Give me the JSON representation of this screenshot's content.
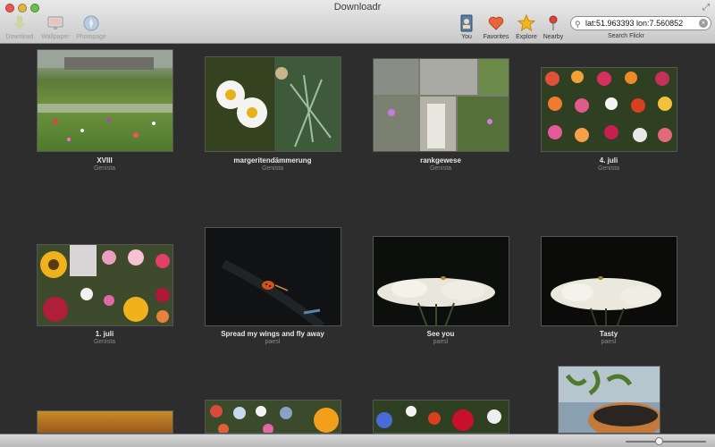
{
  "window": {
    "title": "Downloadr"
  },
  "toolbar": {
    "download_label": "Download",
    "wallpaper_label": "Wallpaper",
    "photopage_label": "Photopage",
    "you_label": "You",
    "favorites_label": "Favorites",
    "explore_label": "Explore",
    "nearby_label": "Nearby"
  },
  "search": {
    "value": "lat:51.963393 lon:7.560852",
    "label": "Search Flickr"
  },
  "photos": [
    {
      "title": "XVIII",
      "owner": "Genista"
    },
    {
      "title": "margeritendämmerung",
      "owner": "Genista"
    },
    {
      "title": "rankgewese",
      "owner": "Genista"
    },
    {
      "title": "4. juli",
      "owner": "Genista"
    },
    {
      "title": "1. juli",
      "owner": "Genista"
    },
    {
      "title": "Spread my wings and fly away",
      "owner": "paesl"
    },
    {
      "title": "See you",
      "owner": "paesl"
    },
    {
      "title": "Tasty",
      "owner": "paesl"
    },
    {
      "title": "",
      "owner": ""
    },
    {
      "title": "",
      "owner": ""
    },
    {
      "title": "",
      "owner": ""
    },
    {
      "title": "",
      "owner": ""
    }
  ],
  "zoom": {
    "level": 0.42
  },
  "colors": {
    "background": "#2d2d2d",
    "accent_favorites": "#e8643a",
    "accent_explore": "#f2b51c"
  }
}
